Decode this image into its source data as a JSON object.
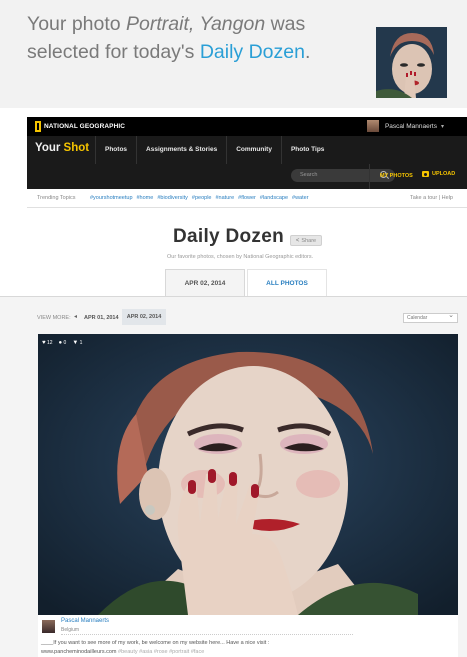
{
  "email": {
    "line1_pre": "Your photo ",
    "photo_title": "Portrait, Yangon",
    "line1_post": " was selected for today's ",
    "link_text": "Daily Dozen",
    "line_end": "."
  },
  "topbar": {
    "logo_text": "NATIONAL GEOGRAPHIC",
    "user_name": "Pascal Mannaerts"
  },
  "nav": {
    "brand_your": "Your",
    "brand_shot": "Shot",
    "links": [
      "Photos",
      "Assignments & Stories",
      "Community",
      "Photo Tips"
    ],
    "search_placeholder": "Search",
    "my_photos": "MY PHOTOS",
    "upload": "UPLOAD"
  },
  "trending": {
    "label": "Trending Topics",
    "tags": [
      "#yourshotmeetup",
      "#home",
      "#biodiversity",
      "#people",
      "#nature",
      "#flower",
      "#landscape",
      "#water"
    ],
    "right": "Take a tour | Help"
  },
  "page": {
    "title": "Daily Dozen",
    "share": "Share",
    "subtitle": "Our favorite photos, chosen by National Geographic editors."
  },
  "tabs": {
    "date": "APR 02, 2014",
    "all": "ALL PHOTOS"
  },
  "gallery": {
    "view_more": "VIEW MORE:",
    "prev_date": "APR 01, 2014",
    "current_date": "APR 02, 2014",
    "calendar": "Calendar"
  },
  "photo": {
    "likes": "12",
    "comments": "0",
    "pins": "1",
    "author": "Pascal Mannaerts",
    "location": "Belgium",
    "caption_text": "____If you want to see more of my work, be welcome on my website here... Have a nice visit :",
    "caption_site": "www.pancheminodailleurs.com",
    "caption_tags": "#beauty #asia #rose #portrait #face"
  },
  "colors": {
    "accent_blue": "#2a9fd6",
    "ng_yellow": "#f5c400",
    "nav_bg": "#1a1a1a"
  }
}
